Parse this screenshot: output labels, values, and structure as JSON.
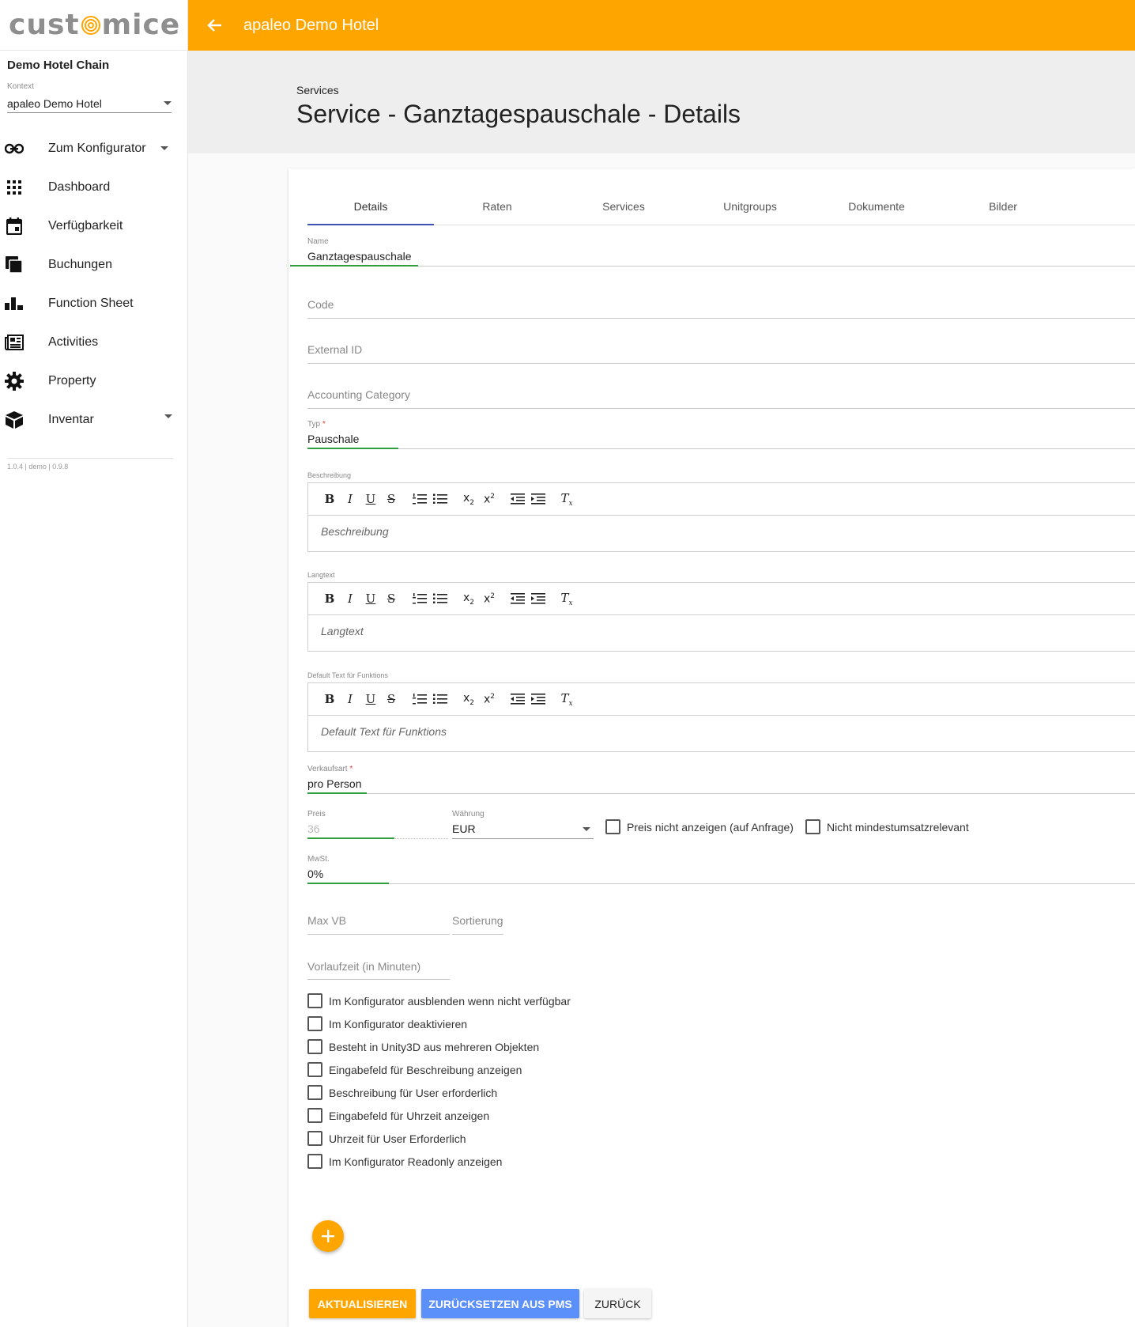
{
  "app": {
    "logo_left": "cust",
    "logo_right": "mice",
    "version": "1.0.4 | demo | 0.9.8"
  },
  "sidebar": {
    "chain": "Demo Hotel Chain",
    "context_label": "Kontext",
    "context_value": "apaleo Demo Hotel",
    "items": [
      {
        "label": "Zum Konfigurator",
        "icon": "link-icon"
      },
      {
        "label": "Dashboard",
        "icon": "grid-icon"
      },
      {
        "label": "Verfügbarkeit",
        "icon": "calendar-icon"
      },
      {
        "label": "Buchungen",
        "icon": "copy-icon"
      },
      {
        "label": "Function Sheet",
        "icon": "bar-chart-icon"
      },
      {
        "label": "Activities",
        "icon": "newspaper-icon"
      },
      {
        "label": "Property",
        "icon": "gear-icon"
      },
      {
        "label": "Inventar",
        "icon": "cube-icon"
      }
    ]
  },
  "topbar": {
    "title": "apaleo Demo Hotel"
  },
  "header": {
    "breadcrumb": "Services",
    "title": "Service - Ganztagespauschale - Details"
  },
  "tabs": [
    "Details",
    "Raten",
    "Services",
    "Unitgroups",
    "Dokumente",
    "Bilder"
  ],
  "form": {
    "name_label": "Name",
    "name_value": "Ganztagespauschale",
    "code_placeholder": "Code",
    "external_id_placeholder": "External ID",
    "accounting_placeholder": "Accounting Category",
    "typ_label": "Typ",
    "typ_value": "Pauschale",
    "required_mark": "*",
    "beschreibung_label": "Beschreibung",
    "beschreibung_placeholder": "Beschreibung",
    "langtext_label": "Langtext",
    "langtext_placeholder": "Langtext",
    "default_text_label": "Default Text für Funktions",
    "default_text_placeholder": "Default Text für Funktions",
    "verkaufsart_label": "Verkaufsart",
    "verkaufsart_value": "pro Person",
    "preis_label": "Preis",
    "preis_value": "36",
    "waehrung_label": "Währung",
    "waehrung_value": "EUR",
    "preis_nicht_anzeigen": "Preis nicht anzeigen (auf Anfrage)",
    "nicht_mindestumsatz": "Nicht mindestumsatzrelevant",
    "mwst_label": "MwSt.",
    "mwst_value": "0%",
    "max_vb_placeholder": "Max VB",
    "sortierung_placeholder": "Sortierung",
    "vorlaufzeit_placeholder": "Vorlaufzeit (in Minuten)"
  },
  "toolbar_buttons": [
    "B",
    "I",
    "U",
    "S"
  ],
  "checkboxes": [
    "Im Konfigurator ausblenden wenn nicht verfügbar",
    "Im Konfigurator deaktivieren",
    "Besteht in Unity3D aus mehreren Objekten",
    "Eingabefeld für Beschreibung anzeigen",
    "Beschreibung für User erforderlich",
    "Eingabefeld für Uhrzeit anzeigen",
    "Uhrzeit für User Erforderlich",
    "Im Konfigurator Readonly anzeigen"
  ],
  "buttons": {
    "update": "AKTUALISIEREN",
    "reset": "ZURÜCKSETZEN AUS PMS",
    "back": "ZURÜCK"
  },
  "colors": {
    "accent": "#ffa500",
    "focus_green": "#2e9e3e",
    "tab_indicator": "#3f51b5",
    "reset_button": "#5b8ff9"
  }
}
